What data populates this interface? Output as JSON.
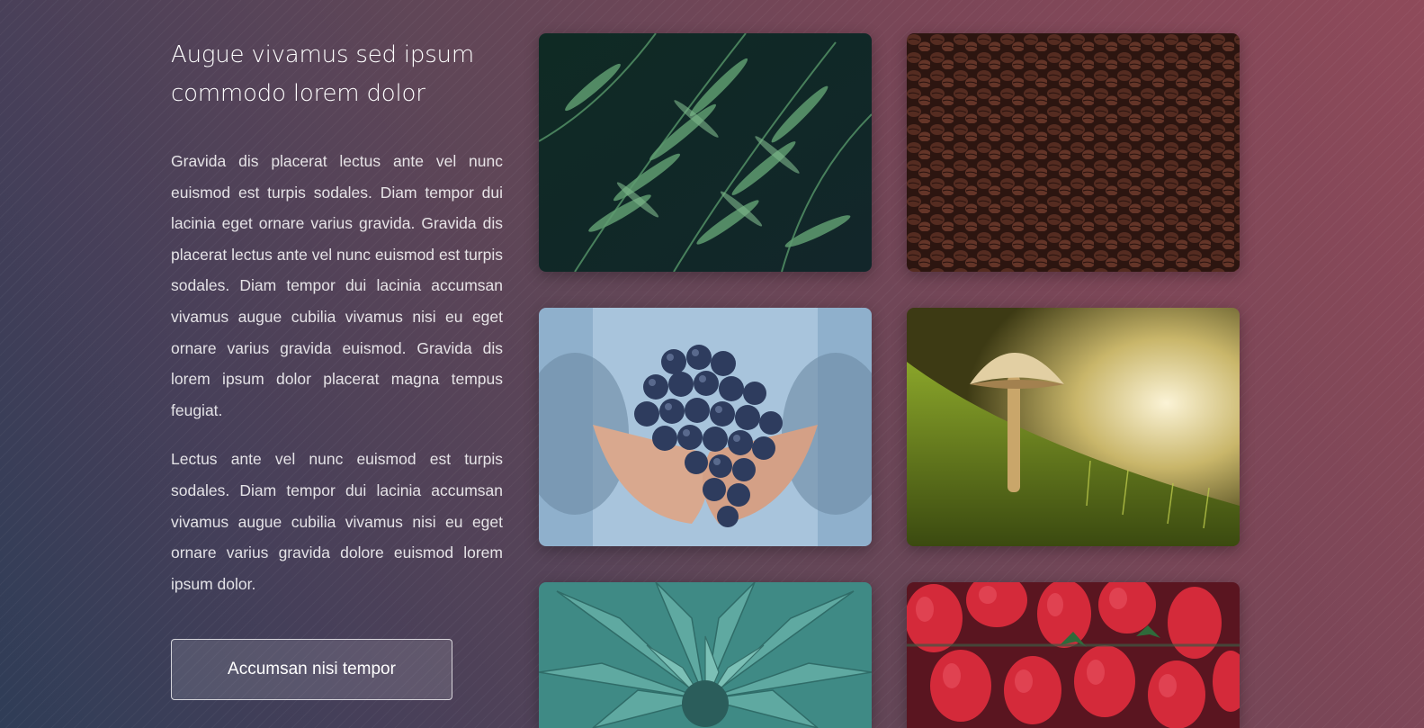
{
  "content": {
    "heading": "Augue vivamus sed ipsum commodo lorem dolor",
    "paragraph_1": "Gravida dis placerat lectus ante vel nunc euismod est turpis sodales. Diam tempor dui lacinia eget ornare varius gravida. Gravida dis placerat lectus ante vel nunc euismod est turpis sodales. Diam tempor dui lacinia accumsan vivamus augue cubilia vivamus nisi eu eget ornare varius gravida euismod. Gravida dis lorem ipsum dolor placerat magna tempus feugiat.",
    "paragraph_2": "Lectus ante vel nunc euismod est turpis sodales. Diam tempor dui lacinia accumsan vivamus augue cubilia vivamus nisi eu eget ornare varius gravida dolore euismod lorem ipsum dolor.",
    "button_label": "Accumsan nisi tempor"
  },
  "gallery": [
    {
      "subject": "fern-leaves"
    },
    {
      "subject": "coffee-beans"
    },
    {
      "subject": "grapes-in-hands"
    },
    {
      "subject": "mushroom-in-moss"
    },
    {
      "subject": "agave-succulent"
    },
    {
      "subject": "strawberries"
    }
  ],
  "colors": {
    "background_start": "#2f3d57",
    "background_end": "#8f4a5a",
    "text": "#ffffff",
    "button_border": "#ffffff"
  }
}
